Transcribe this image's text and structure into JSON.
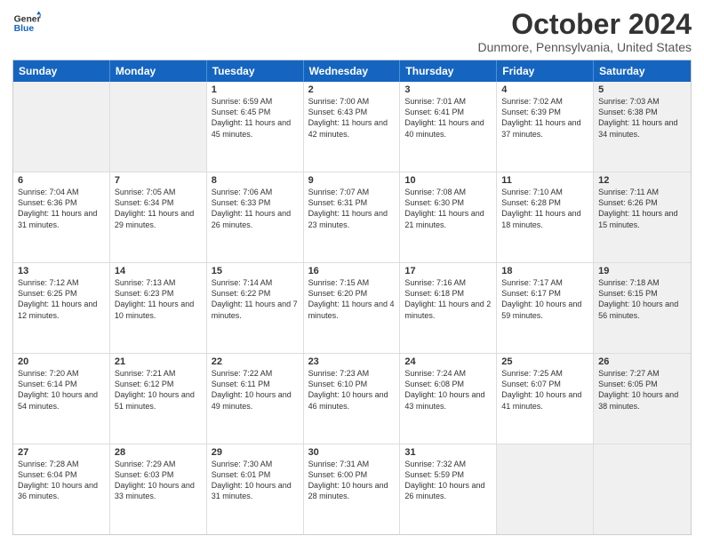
{
  "logo": {
    "line1": "General",
    "line2": "Blue"
  },
  "title": "October 2024",
  "location": "Dunmore, Pennsylvania, United States",
  "days_of_week": [
    "Sunday",
    "Monday",
    "Tuesday",
    "Wednesday",
    "Thursday",
    "Friday",
    "Saturday"
  ],
  "weeks": [
    [
      {
        "day": "",
        "info": "",
        "shaded": true
      },
      {
        "day": "",
        "info": "",
        "shaded": true
      },
      {
        "day": "1",
        "info": "Sunrise: 6:59 AM\nSunset: 6:45 PM\nDaylight: 11 hours and 45 minutes."
      },
      {
        "day": "2",
        "info": "Sunrise: 7:00 AM\nSunset: 6:43 PM\nDaylight: 11 hours and 42 minutes."
      },
      {
        "day": "3",
        "info": "Sunrise: 7:01 AM\nSunset: 6:41 PM\nDaylight: 11 hours and 40 minutes."
      },
      {
        "day": "4",
        "info": "Sunrise: 7:02 AM\nSunset: 6:39 PM\nDaylight: 11 hours and 37 minutes."
      },
      {
        "day": "5",
        "info": "Sunrise: 7:03 AM\nSunset: 6:38 PM\nDaylight: 11 hours and 34 minutes.",
        "shaded": true
      }
    ],
    [
      {
        "day": "6",
        "info": "Sunrise: 7:04 AM\nSunset: 6:36 PM\nDaylight: 11 hours and 31 minutes."
      },
      {
        "day": "7",
        "info": "Sunrise: 7:05 AM\nSunset: 6:34 PM\nDaylight: 11 hours and 29 minutes."
      },
      {
        "day": "8",
        "info": "Sunrise: 7:06 AM\nSunset: 6:33 PM\nDaylight: 11 hours and 26 minutes."
      },
      {
        "day": "9",
        "info": "Sunrise: 7:07 AM\nSunset: 6:31 PM\nDaylight: 11 hours and 23 minutes."
      },
      {
        "day": "10",
        "info": "Sunrise: 7:08 AM\nSunset: 6:30 PM\nDaylight: 11 hours and 21 minutes."
      },
      {
        "day": "11",
        "info": "Sunrise: 7:10 AM\nSunset: 6:28 PM\nDaylight: 11 hours and 18 minutes."
      },
      {
        "day": "12",
        "info": "Sunrise: 7:11 AM\nSunset: 6:26 PM\nDaylight: 11 hours and 15 minutes.",
        "shaded": true
      }
    ],
    [
      {
        "day": "13",
        "info": "Sunrise: 7:12 AM\nSunset: 6:25 PM\nDaylight: 11 hours and 12 minutes."
      },
      {
        "day": "14",
        "info": "Sunrise: 7:13 AM\nSunset: 6:23 PM\nDaylight: 11 hours and 10 minutes."
      },
      {
        "day": "15",
        "info": "Sunrise: 7:14 AM\nSunset: 6:22 PM\nDaylight: 11 hours and 7 minutes."
      },
      {
        "day": "16",
        "info": "Sunrise: 7:15 AM\nSunset: 6:20 PM\nDaylight: 11 hours and 4 minutes."
      },
      {
        "day": "17",
        "info": "Sunrise: 7:16 AM\nSunset: 6:18 PM\nDaylight: 11 hours and 2 minutes."
      },
      {
        "day": "18",
        "info": "Sunrise: 7:17 AM\nSunset: 6:17 PM\nDaylight: 10 hours and 59 minutes."
      },
      {
        "day": "19",
        "info": "Sunrise: 7:18 AM\nSunset: 6:15 PM\nDaylight: 10 hours and 56 minutes.",
        "shaded": true
      }
    ],
    [
      {
        "day": "20",
        "info": "Sunrise: 7:20 AM\nSunset: 6:14 PM\nDaylight: 10 hours and 54 minutes."
      },
      {
        "day": "21",
        "info": "Sunrise: 7:21 AM\nSunset: 6:12 PM\nDaylight: 10 hours and 51 minutes."
      },
      {
        "day": "22",
        "info": "Sunrise: 7:22 AM\nSunset: 6:11 PM\nDaylight: 10 hours and 49 minutes."
      },
      {
        "day": "23",
        "info": "Sunrise: 7:23 AM\nSunset: 6:10 PM\nDaylight: 10 hours and 46 minutes."
      },
      {
        "day": "24",
        "info": "Sunrise: 7:24 AM\nSunset: 6:08 PM\nDaylight: 10 hours and 43 minutes."
      },
      {
        "day": "25",
        "info": "Sunrise: 7:25 AM\nSunset: 6:07 PM\nDaylight: 10 hours and 41 minutes."
      },
      {
        "day": "26",
        "info": "Sunrise: 7:27 AM\nSunset: 6:05 PM\nDaylight: 10 hours and 38 minutes.",
        "shaded": true
      }
    ],
    [
      {
        "day": "27",
        "info": "Sunrise: 7:28 AM\nSunset: 6:04 PM\nDaylight: 10 hours and 36 minutes."
      },
      {
        "day": "28",
        "info": "Sunrise: 7:29 AM\nSunset: 6:03 PM\nDaylight: 10 hours and 33 minutes."
      },
      {
        "day": "29",
        "info": "Sunrise: 7:30 AM\nSunset: 6:01 PM\nDaylight: 10 hours and 31 minutes."
      },
      {
        "day": "30",
        "info": "Sunrise: 7:31 AM\nSunset: 6:00 PM\nDaylight: 10 hours and 28 minutes."
      },
      {
        "day": "31",
        "info": "Sunrise: 7:32 AM\nSunset: 5:59 PM\nDaylight: 10 hours and 26 minutes."
      },
      {
        "day": "",
        "info": "",
        "shaded": true
      },
      {
        "day": "",
        "info": "",
        "shaded": true
      }
    ]
  ]
}
